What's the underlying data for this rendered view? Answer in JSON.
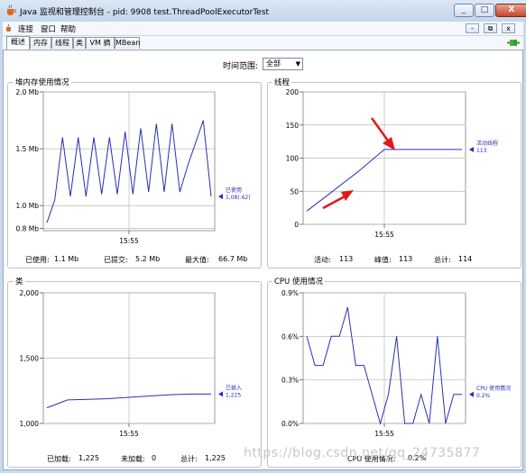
{
  "window": {
    "title": "Java 监视和管理控制台 - pid: 9908 test.ThreadPoolExecutorTest",
    "buttons": {
      "minimize": "_",
      "maximize": "□",
      "close": "X"
    }
  },
  "menu": {
    "items": [
      "连接",
      "窗口",
      "帮助"
    ]
  },
  "mdi_buttons": [
    "-",
    "⧉",
    "x"
  ],
  "tabs": [
    "概述",
    "内存",
    "线程",
    "类",
    "VM 摘要",
    "MBean"
  ],
  "active_tab": 0,
  "time_range": {
    "label": "时间范围:",
    "value": "全部"
  },
  "colors": {
    "series": "#2a2fb6",
    "grid": "#b8b8b8",
    "accent_green": "#2f9e2f",
    "arrow": "#e01818"
  },
  "panels": {
    "heap": {
      "title": "堆内存使用情况",
      "time_label": "15:55",
      "stats": [
        {
          "label": "已使用:",
          "value": "1.1  Mb"
        },
        {
          "label": "已提交:",
          "value": "5.2  Mb"
        },
        {
          "label": "最大值:",
          "value": "66.7  Mb"
        }
      ],
      "legend": {
        "name": "已使用",
        "value": "1,08(.62)"
      }
    },
    "threads": {
      "title": "线程",
      "time_label": "15:55",
      "stats": [
        {
          "label": "活动:",
          "value": "113"
        },
        {
          "label": "峰值:",
          "value": "113"
        },
        {
          "label": "总计:",
          "value": "114"
        }
      ],
      "legend": {
        "name": "活动线程",
        "value": "113"
      }
    },
    "classes": {
      "title": "类",
      "time_label": "15:55",
      "stats": [
        {
          "label": "已加载:",
          "value": "1,225"
        },
        {
          "label": "未加载:",
          "value": "0"
        },
        {
          "label": "总计:",
          "value": "1,225"
        }
      ],
      "legend": {
        "name": "已装入",
        "value": "1,225"
      }
    },
    "cpu": {
      "title": "CPU 使用情况",
      "time_label": "15:55",
      "stats": [
        {
          "label": "CPU 使用情况:",
          "value": "0.2%"
        }
      ],
      "legend": {
        "name": "CPU 使用情况",
        "value": "0.2%"
      }
    }
  },
  "chart_data": [
    {
      "type": "line",
      "title": "堆内存使用情况",
      "y_ticks": [
        "2.0 Mb",
        "1.5 Mb",
        "1.0 Mb",
        "0.8 Mb"
      ],
      "ylim": [
        0.78,
        2.0
      ],
      "x_tick": "15:55",
      "series": [
        {
          "name": "已使用",
          "values": [
            0.85,
            1.05,
            1.6,
            1.08,
            1.6,
            1.08,
            1.6,
            1.1,
            1.6,
            1.1,
            1.65,
            1.1,
            1.68,
            1.12,
            1.72,
            1.12,
            1.72,
            1.12,
            1.35,
            1.55,
            1.75,
            1.08
          ]
        }
      ]
    },
    {
      "type": "line",
      "title": "线程",
      "y_ticks": [
        "200",
        "150",
        "100",
        "50",
        "0"
      ],
      "ylim": [
        0,
        200
      ],
      "x_tick": "15:55",
      "series": [
        {
          "name": "活动线程",
          "values": [
            20,
            50,
            80,
            113,
            113,
            113,
            113
          ]
        }
      ]
    },
    {
      "type": "line",
      "title": "类",
      "y_ticks": [
        "2,000",
        "1,500",
        "1,000"
      ],
      "ylim": [
        1000,
        2000
      ],
      "x_tick": "15:55",
      "series": [
        {
          "name": "已装入",
          "values": [
            1120,
            1180,
            1185,
            1190,
            1200,
            1210,
            1220,
            1225,
            1225
          ]
        }
      ]
    },
    {
      "type": "line",
      "title": "CPU 使用情况",
      "y_ticks": [
        "0.9%",
        "0.6%",
        "0.3%",
        "0.0%"
      ],
      "ylim": [
        0,
        0.9
      ],
      "x_tick": "15:55",
      "series": [
        {
          "name": "CPU 使用情况",
          "values": [
            0.6,
            0.4,
            0.4,
            0.6,
            0.6,
            0.8,
            0.4,
            0.4,
            0.2,
            0.0,
            0.2,
            0.6,
            0.0,
            0.0,
            0.2,
            0.0,
            0.6,
            0.0,
            0.2,
            0.2
          ]
        }
      ]
    }
  ],
  "watermark": "https://blog.csdn.net/qq_24735877"
}
